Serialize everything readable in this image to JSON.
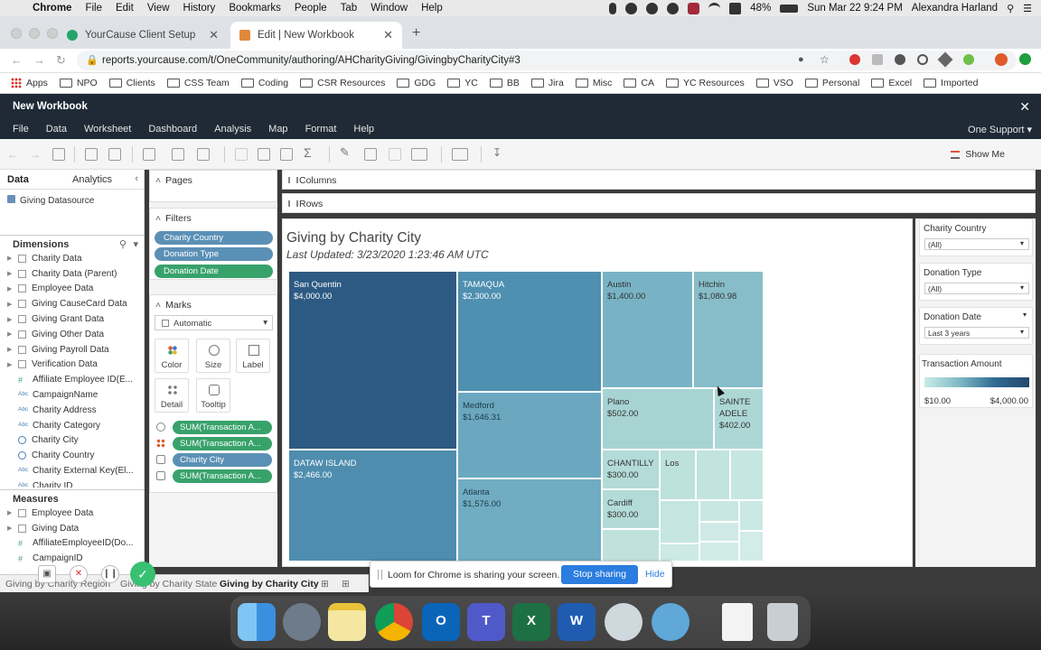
{
  "mac_menu": {
    "app": "Chrome",
    "items": [
      "File",
      "Edit",
      "View",
      "History",
      "Bookmarks",
      "People",
      "Tab",
      "Window",
      "Help"
    ],
    "battery": "48%",
    "datetime": "Sun Mar 22  9:24 PM",
    "user": "Alexandra Harland"
  },
  "browser": {
    "tabs": [
      {
        "title": "YourCause Client Setup",
        "active": false
      },
      {
        "title": "Edit | New Workbook",
        "active": true
      }
    ],
    "url": "reports.yourcause.com/t/OneCommunity/authoring/AHCharityGiving/GivingbyCharityCity#3",
    "bookmarks": [
      "Apps",
      "NPO",
      "Clients",
      "CSS Team",
      "Coding",
      "CSR Resources",
      "GDG",
      "YC",
      "BB",
      "Jira",
      "Misc",
      "CA",
      "YC Resources",
      "VSO",
      "Personal",
      "Excel",
      "Imported"
    ]
  },
  "tableau": {
    "window_title": "New Workbook",
    "menu": [
      "File",
      "Data",
      "Worksheet",
      "Dashboard",
      "Analysis",
      "Map",
      "Format",
      "Help"
    ],
    "support": "One Support ▾",
    "show_me": "Show Me",
    "data_pane": {
      "tab_data": "Data",
      "tab_analytics": "Analytics",
      "datasource": "Giving Datasource",
      "dimensions_label": "Dimensions",
      "dimensions": [
        {
          "name": "Charity Data",
          "icon": "folder"
        },
        {
          "name": "Charity Data (Parent)",
          "icon": "folder"
        },
        {
          "name": "Employee Data",
          "icon": "folder"
        },
        {
          "name": "Giving CauseCard Data",
          "icon": "folder"
        },
        {
          "name": "Giving Grant Data",
          "icon": "folder"
        },
        {
          "name": "Giving Other Data",
          "icon": "folder"
        },
        {
          "name": "Giving Payroll Data",
          "icon": "folder"
        },
        {
          "name": "Verification Data",
          "icon": "folder"
        },
        {
          "name": "Affiliate Employee ID(E...",
          "icon": "hash"
        },
        {
          "name": "CampaignName",
          "icon": "abc"
        },
        {
          "name": "Charity Address",
          "icon": "abc"
        },
        {
          "name": "Charity Category",
          "icon": "abc"
        },
        {
          "name": "Charity City",
          "icon": "globe"
        },
        {
          "name": "Charity Country",
          "icon": "globe"
        },
        {
          "name": "Charity External Key(El...",
          "icon": "abc"
        },
        {
          "name": "Charity ID",
          "icon": "abc"
        }
      ],
      "measures_label": "Measures",
      "measures": [
        {
          "name": "Employee Data",
          "icon": "folder"
        },
        {
          "name": "Giving Data",
          "icon": "folder"
        },
        {
          "name": "AffiliateEmployeeID(Do...",
          "icon": "hash"
        },
        {
          "name": "CampaignID",
          "icon": "hash"
        }
      ]
    },
    "pages_label": "Pages",
    "filters_label": "Filters",
    "filters": [
      "Charity Country",
      "Donation Type",
      "Donation Date"
    ],
    "marks_label": "Marks",
    "marks_type": "Automatic",
    "marks_buttons": [
      "Color",
      "Size",
      "Label",
      "Detail",
      "Tooltip"
    ],
    "marks_pills": [
      "SUM(Transaction A...",
      "SUM(Transaction A...",
      "Charity City",
      "SUM(Transaction A..."
    ],
    "columns_label": "Columns",
    "rows_label": "Rows",
    "viz_title": "Giving by Charity City",
    "viz_subtitle": "Last Updated: 3/23/2020 1:23:46 AM UTC",
    "right_filters": [
      {
        "title": "Charity Country",
        "value": "(All)"
      },
      {
        "title": "Donation Type",
        "value": "(All)"
      },
      {
        "title": "Donation Date",
        "value": "Last 3 years"
      }
    ],
    "legend": {
      "title": "Transaction Amount",
      "min": "$10.00",
      "max": "$4,000.00"
    },
    "sheet_tabs": [
      "Giving by Charity Region",
      "Giving by Charity State",
      "Giving by Charity City"
    ]
  },
  "chart_data": {
    "type": "treemap",
    "title": "Giving by Charity City",
    "color_scale": {
      "min": 10,
      "max": 4000,
      "from": "#c9ebe6",
      "to": "#24486c"
    },
    "items": [
      {
        "city": "San Quentin",
        "value": "$4,000.00",
        "color": "#2d5a82"
      },
      {
        "city": "DATAW ISLAND",
        "value": "$2,466.00",
        "color": "#4e8dae"
      },
      {
        "city": "TAMAQUA",
        "value": "$2,300.00",
        "color": "#4f8fb0"
      },
      {
        "city": "Medford",
        "value": "$1,646.31",
        "color": "#6ba8c0"
      },
      {
        "city": "Atlanta",
        "value": "$1,576.00",
        "color": "#70acc2"
      },
      {
        "city": "Austin",
        "value": "$1,400.00",
        "color": "#78b3c5"
      },
      {
        "city": "Hitchin",
        "value": "$1,080.98",
        "color": "#86bdc9"
      },
      {
        "city": "Plano",
        "value": "$502.00",
        "color": "#a7d3d3"
      },
      {
        "city": "SAINTE ADELE",
        "value": "$402.00",
        "color": "#acd7d5"
      },
      {
        "city": "CHANTILLY",
        "value": "$300.00",
        "color": "#b3dbd8"
      },
      {
        "city": "Cardiff",
        "value": "$300.00",
        "color": "#b3dbd8"
      },
      {
        "city": "Los",
        "value": "",
        "color": "#bde1dc"
      }
    ]
  },
  "loom": {
    "message": "Loom for Chrome is sharing your screen.",
    "stop": "Stop sharing",
    "hide": "Hide"
  }
}
